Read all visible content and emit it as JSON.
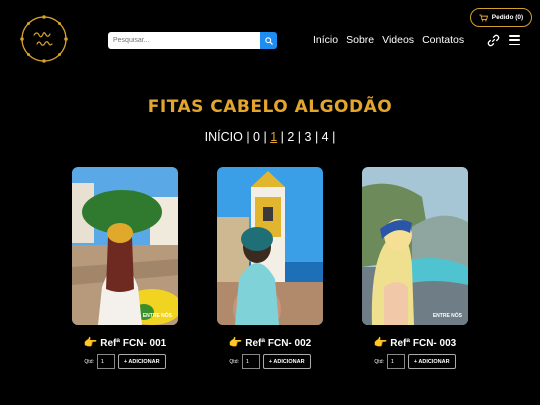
{
  "header": {
    "logo_text": "entre nós",
    "search": {
      "placeholder": "Pesquisar..."
    },
    "nav": [
      "Início",
      "Sobre",
      "Videos",
      "Contatos"
    ],
    "cart_label": "Pedido (0)"
  },
  "page": {
    "title": "FITAS CABELO ALGODÃO",
    "pager": {
      "start": "INÍCIO",
      "pages": [
        "0",
        "1",
        "2",
        "3",
        "4"
      ],
      "active": "1"
    }
  },
  "products": [
    {
      "ref": "Refª FCN- 001",
      "qty_label": "Qtd:",
      "qty": "1",
      "add_label": "+ ADICIONAR",
      "watermark": "ENTRE NÓS"
    },
    {
      "ref": "Refª FCN- 002",
      "qty_label": "Qtd:",
      "qty": "1",
      "add_label": "+ ADICIONAR",
      "watermark": ""
    },
    {
      "ref": "Refª FCN- 003",
      "qty_label": "Qtd:",
      "qty": "1",
      "add_label": "+ ADICIONAR",
      "watermark": "ENTRE NÓS"
    }
  ],
  "colors": {
    "accent": "#e3a62d",
    "search_button": "#1e8df0",
    "background": "#000000"
  },
  "icons": [
    "search-icon",
    "cart-icon",
    "link-icon",
    "menu-icon",
    "pointing-hand-icon"
  ]
}
